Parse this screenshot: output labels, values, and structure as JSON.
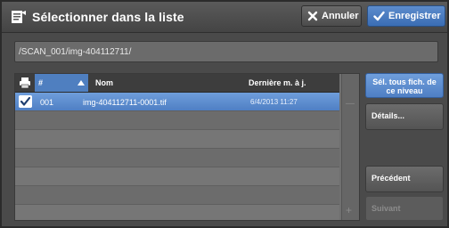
{
  "header": {
    "title": "Sélectionner dans la liste",
    "cancel_label": "Annuler",
    "save_label": "Enregistrer"
  },
  "path": "/SCAN_001/img-404112711/",
  "list": {
    "columns": {
      "number": "#",
      "name": "Nom",
      "modified": "Dernière m. à j."
    },
    "rows": [
      {
        "number": "001",
        "name": "img-404112711-0001.tif",
        "modified": "6/4/2013 11:27",
        "selected": true
      }
    ]
  },
  "side": {
    "select_all": "Sél. tous fich. de ce niveau",
    "details": "Détails...",
    "previous": "Précédent",
    "next": "Suivant"
  },
  "colors": {
    "accent": "#4f7fc4",
    "background": "#4a4a4a"
  },
  "icons": [
    "document-list-icon",
    "x-icon",
    "checkmark-icon",
    "printer-icon",
    "sort-up-icon",
    "checkbox-checked-icon",
    "scroll-up-icon",
    "scroll-down-icon"
  ]
}
